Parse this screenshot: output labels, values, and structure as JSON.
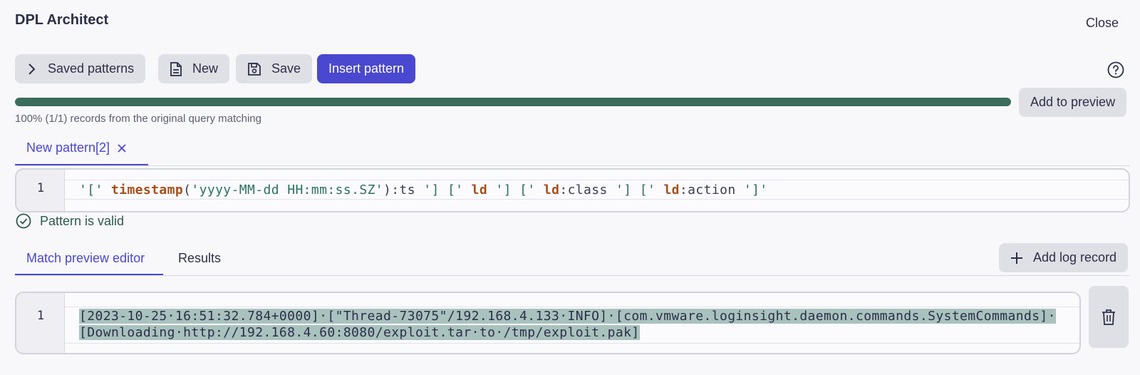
{
  "header": {
    "title": "DPL Architect",
    "close_label": "Close"
  },
  "toolbar": {
    "saved_patterns_label": "Saved patterns",
    "new_label": "New",
    "save_label": "Save",
    "insert_label": "Insert pattern",
    "add_preview_label": "Add to preview"
  },
  "match": {
    "percent": 100,
    "text": "100% (1/1) records from the original query matching"
  },
  "pattern_tabs": [
    {
      "label": "New pattern[2]"
    }
  ],
  "pattern_editor": {
    "line_number": "1",
    "tokens": [
      {
        "t": "'['",
        "c": "str"
      },
      {
        "t": " ",
        "c": "plain"
      },
      {
        "t": "timestamp",
        "c": "kw"
      },
      {
        "t": "(",
        "c": "plain"
      },
      {
        "t": "'yyyy-MM-dd HH:mm:ss.SZ'",
        "c": "str"
      },
      {
        "t": "):ts ",
        "c": "plain"
      },
      {
        "t": "'] ['",
        "c": "str"
      },
      {
        "t": " ",
        "c": "plain"
      },
      {
        "t": "ld",
        "c": "kw"
      },
      {
        "t": " ",
        "c": "plain"
      },
      {
        "t": "'] ['",
        "c": "str"
      },
      {
        "t": " ",
        "c": "plain"
      },
      {
        "t": "ld",
        "c": "kw"
      },
      {
        "t": ":class ",
        "c": "plain"
      },
      {
        "t": "'] ['",
        "c": "str"
      },
      {
        "t": " ",
        "c": "plain"
      },
      {
        "t": "ld",
        "c": "kw"
      },
      {
        "t": ":action ",
        "c": "plain"
      },
      {
        "t": "']'",
        "c": "str"
      }
    ]
  },
  "validation": {
    "text": "Pattern is valid"
  },
  "preview_tabs": {
    "editor_label": "Match preview editor",
    "results_label": "Results"
  },
  "add_log_label": "Add log record",
  "log_editor": {
    "line_number": "1",
    "line1": "[2023-10-25·16:51:32.784+0000]·[\"Thread-73075\"/192.168.4.133·INFO]·[com.vmware.loginsight.daemon.commands.SystemCommands]·",
    "line2": "[Downloading·http://192.168.4.60:8080/exploit.tar·to·/tmp/exploit.pak]"
  },
  "colors": {
    "accent": "#4a47d0",
    "progress": "#3b6b5a",
    "valid": "#2e5a4c",
    "selection": "#a9c2bd"
  }
}
